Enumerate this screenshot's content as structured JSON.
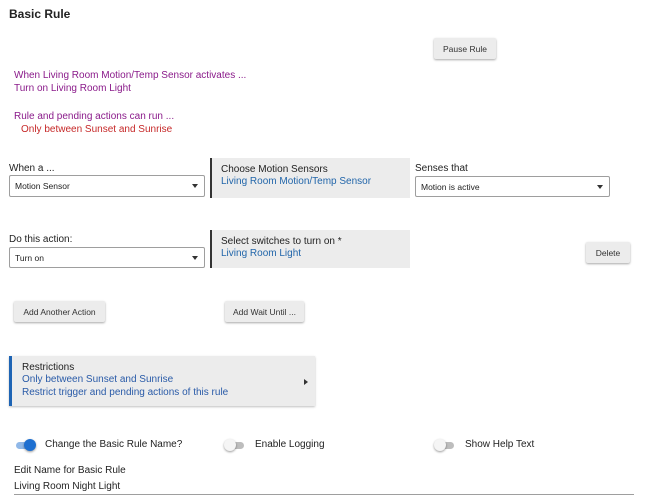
{
  "page": {
    "title": "Basic Rule"
  },
  "header": {
    "pause_button": "Pause Rule"
  },
  "summary": {
    "trigger_line": "When Living Room Motion/Temp Sensor activates ...",
    "action_line": "Turn on Living Room Light",
    "conditions_line": "Rule and pending actions can run ...",
    "restriction_line": "Only between Sunset and Sunrise"
  },
  "trigger": {
    "label": "When a ...",
    "selected": "Motion Sensor",
    "device_card_title": "Choose Motion Sensors",
    "device_card_value": "Living Room Motion/Temp Sensor",
    "senses_label": "Senses that",
    "senses_selected": "Motion is active"
  },
  "action": {
    "label": "Do this action:",
    "selected": "Turn on",
    "device_card_title": "Select switches to turn on *",
    "device_card_value": "Living Room Light",
    "delete_button": "Delete"
  },
  "buttons": {
    "add_action": "Add Another Action",
    "add_wait": "Add Wait Until ..."
  },
  "restrictions": {
    "title": "Restrictions",
    "line1": "Only between Sunset and Sunrise",
    "line2": "Restrict trigger and pending actions of this rule"
  },
  "toggles": [
    {
      "label": "Change the Basic Rule Name?",
      "on": true
    },
    {
      "label": "Enable Logging",
      "on": false
    },
    {
      "label": "Show Help Text",
      "on": false
    }
  ],
  "name_field": {
    "label": "Edit Name for Basic Rule",
    "value": "Living Room Night Light"
  },
  "colors": {
    "summary_purple": "#8a1a8a",
    "restriction_red": "#c62828",
    "link_blue": "#2266aa",
    "toggle_on": "#1e6fd0"
  }
}
